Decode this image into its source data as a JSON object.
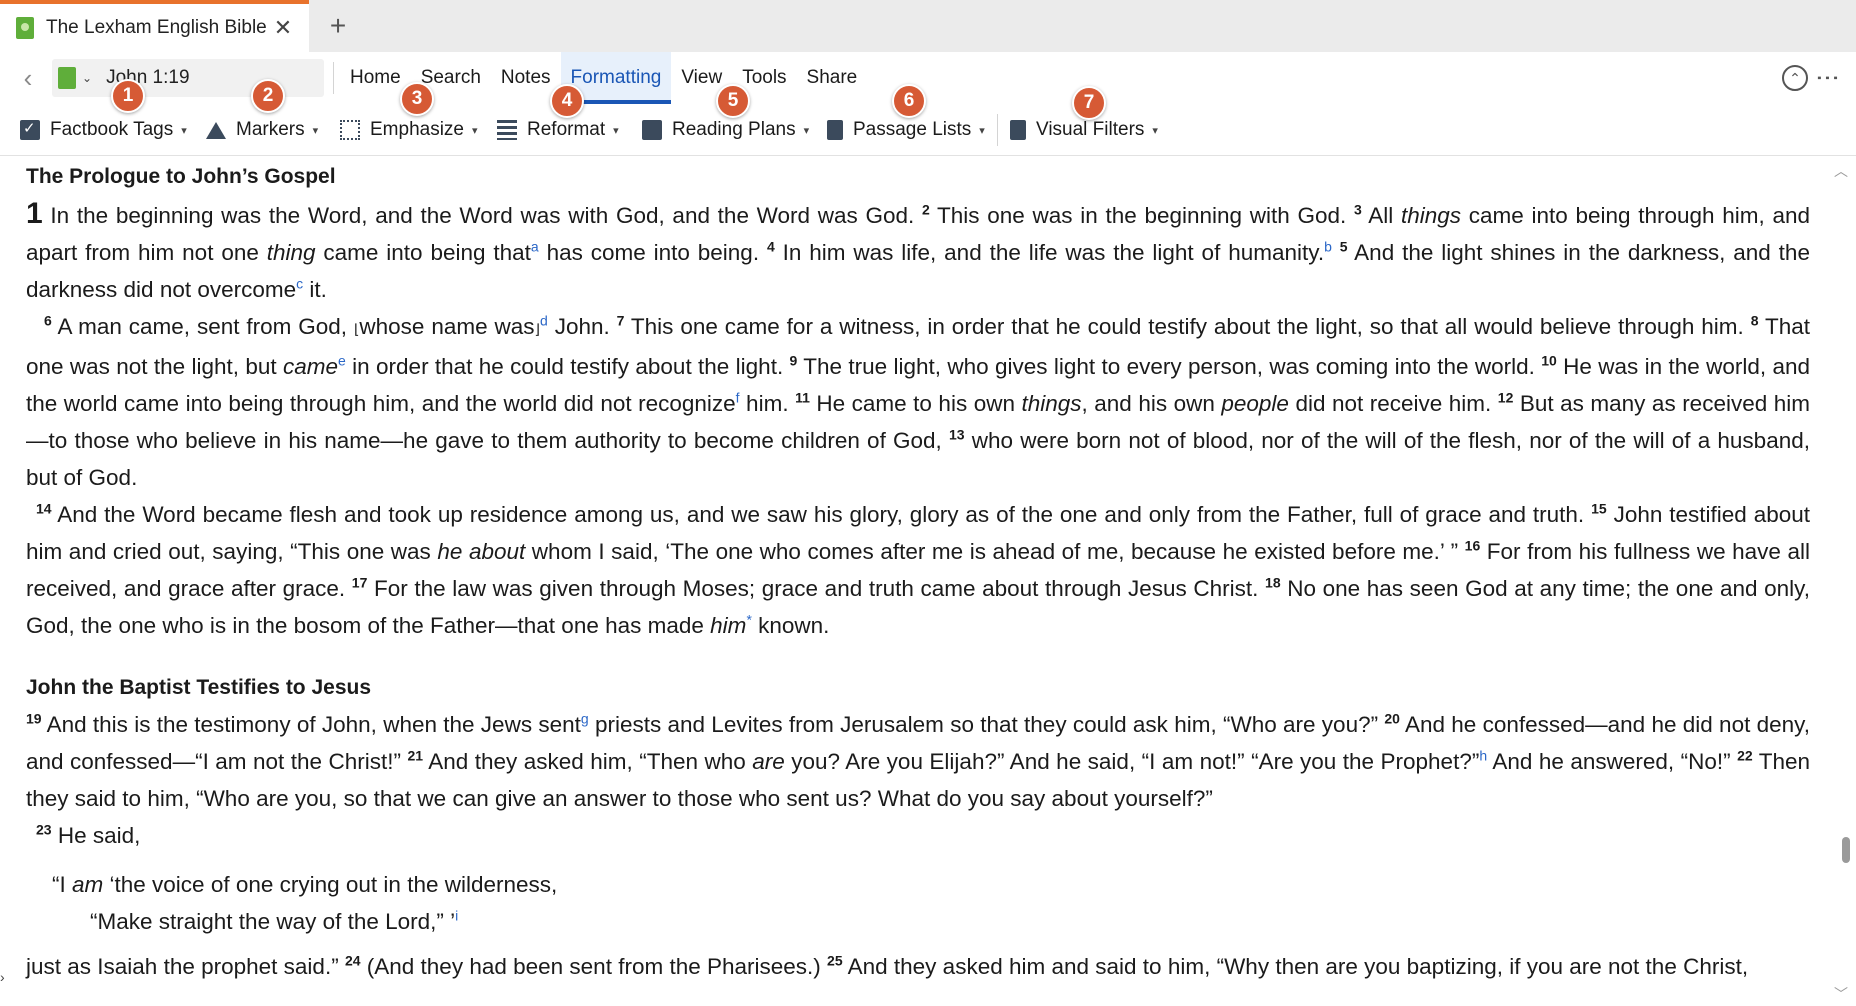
{
  "tab": {
    "title": "The Lexham English Bible",
    "close": "✕",
    "new": "+"
  },
  "nav": {
    "back": "‹",
    "reference": "John 1:19",
    "menu": [
      "Home",
      "Search",
      "Notes",
      "Formatting",
      "View",
      "Tools",
      "Share"
    ],
    "active_menu": "Formatting",
    "collapse": "⌃",
    "more": "⋮"
  },
  "toolbar": {
    "items": [
      "Factbook Tags",
      "Markers",
      "Emphasize",
      "Reformat",
      "Reading Plans",
      "Passage Lists",
      "Visual Filters"
    ],
    "badges": [
      "1",
      "2",
      "3",
      "4",
      "5",
      "6",
      "7"
    ]
  },
  "text": {
    "heading1": "The Prologue to John’s Gospel",
    "p1": {
      "ch": "1",
      "a": " In the beginning was the Word, and the Word was with God, and the Word was God. ",
      "v2": "2",
      "b": " This one was in the beginning with God. ",
      "v3": "3",
      "c": " All ",
      "c_i": "things",
      "d": " came into being through him, and apart from him not one ",
      "d_i": "thing",
      "e": " came into being that",
      "fa": "a",
      "f": " has come into being. ",
      "v4": "4",
      "g": " In him was life, and the life was the light of humanity.",
      "fb": "b",
      "h": " ",
      "v5": "5",
      "i": " And the light shines in the darkness, and the darkness did not overcome",
      "fc": "c",
      "j": " it."
    },
    "p2": {
      "v6": "6",
      "a": " A man came, sent from God, ",
      "lb": "⌊",
      "a2": "whose name was",
      "rb": "⌋",
      "fd": "d",
      "b": " John. ",
      "v7": "7",
      "c": " This one came for a witness, in order that he could testify about the light, so that all would believe through him. ",
      "v8": "8",
      "d": " That one was not the light, but ",
      "d_i": "came",
      "fe": "e",
      "e": " in order that he could testify about the light. ",
      "v9": "9",
      "f": " The true light, who gives light to every person, was coming into the world. ",
      "v10": "10",
      "g": " He was in the world, and the world came into being through him, and the world did not recognize",
      "ff": "f",
      "h": " him. ",
      "v11": "11",
      "i": " He came to his own ",
      "i_i": "things",
      "j": ", and his own ",
      "j_i": "people",
      "k": " did not receive him. ",
      "v12": "12",
      "l": " But as many as received him—to those who believe in his name—he gave to them authority to become children of God, ",
      "v13": "13",
      "m": " who were born not of blood, nor of the will of the flesh, nor of the will of a husband, but of God."
    },
    "p3": {
      "v14": "14",
      "a": " And the Word became flesh and took up residence among us, and we saw his glory, glory as of the one and only from the Father, full of grace and truth. ",
      "v15": "15",
      "b": " John testified about him and cried out, saying, “This one was ",
      "b_i": "he about",
      "c": " whom I said, ‘The one who comes after me is ahead of me, because he existed before me.’ ” ",
      "v16": "16",
      "d": " For from his fullness we have all received, and grace after grace. ",
      "v17": "17",
      "e": " For the law was given through Moses; grace and truth came about through Jesus Christ. ",
      "v18": "18",
      "f": " No one has seen God at any time; the one and only, God, the one who is in the bosom of the Father—that one has made ",
      "f_i": "him",
      "fstar": "*",
      "g": " known."
    },
    "heading2": "John the Baptist Testifies to Jesus",
    "p4": {
      "v19": "19",
      "a": " And this is the testimony of John, when the Jews sent",
      "fg": "g",
      "b": " priests and Levites from Jerusalem so that they could ask him, “Who are you?” ",
      "v20": "20",
      "c": " And he confessed—and he did not deny, and confessed—“I am not the Christ!” ",
      "v21": "21",
      "d": " And they asked him, “Then who ",
      "d_i": "are",
      "e": " you? Are you Elijah?” And he said, “I am not!” “Are you the Prophet?”",
      "fh": "h",
      "f": " And he answered, “No!” ",
      "v22": "22",
      "g": " Then they said to him, “Who are you, so that we can give an answer to those who sent us? What do you say about yourself?”"
    },
    "p5": {
      "v23": "23",
      "a": " He said,"
    },
    "poetry": {
      "l1a": "“I ",
      "l1_i": "am",
      "l1b": " ‘the voice of one crying out in the wilderness,",
      "l2": "“Make straight the way of the Lord,” ’",
      "fi": "i"
    },
    "p6": {
      "a": "just as Isaiah the prophet said.” ",
      "v24": "24",
      "b": " (And they had been sent from the Pharisees.) ",
      "v25": "25",
      "c": " And they asked him and said to him, “Why then are you baptizing, if you are not the Christ,"
    }
  },
  "colors": {
    "accent": "#1a56b5",
    "badge": "#d65a35",
    "tab_highlight": "#e8722c",
    "footnote": "#2b67c7"
  }
}
